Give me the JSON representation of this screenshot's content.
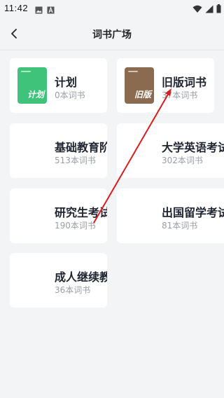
{
  "status": {
    "time": "11:42",
    "left_icons": [
      "image-icon",
      "font-icon"
    ],
    "right_icons": [
      "wifi-icon",
      "signal-icon",
      "battery-icon"
    ]
  },
  "header": {
    "title": "词书广场",
    "back_icon": "chevron-left-icon"
  },
  "cards": [
    {
      "title": "计划",
      "count": "0本词书",
      "cover": {
        "label": "计划",
        "color": "#3fc27a"
      }
    },
    {
      "title": "旧版词书",
      "count": "37本词书",
      "cover": {
        "label": "旧版",
        "color": "#8b6b4f"
      }
    },
    {
      "title": "基础教育阶段",
      "count": "513本词书"
    },
    {
      "title": "大学英语考试",
      "count": "302本词书"
    },
    {
      "title": "研究生考试",
      "count": "190本词书"
    },
    {
      "title": "出国留学考试",
      "count": "81本词书"
    },
    {
      "title": "成人继续教育",
      "count": "36本词书"
    }
  ],
  "colors": {
    "background": "#f3f4f6",
    "card": "#ffffff",
    "annotation_arrow": "#d81e1e"
  }
}
